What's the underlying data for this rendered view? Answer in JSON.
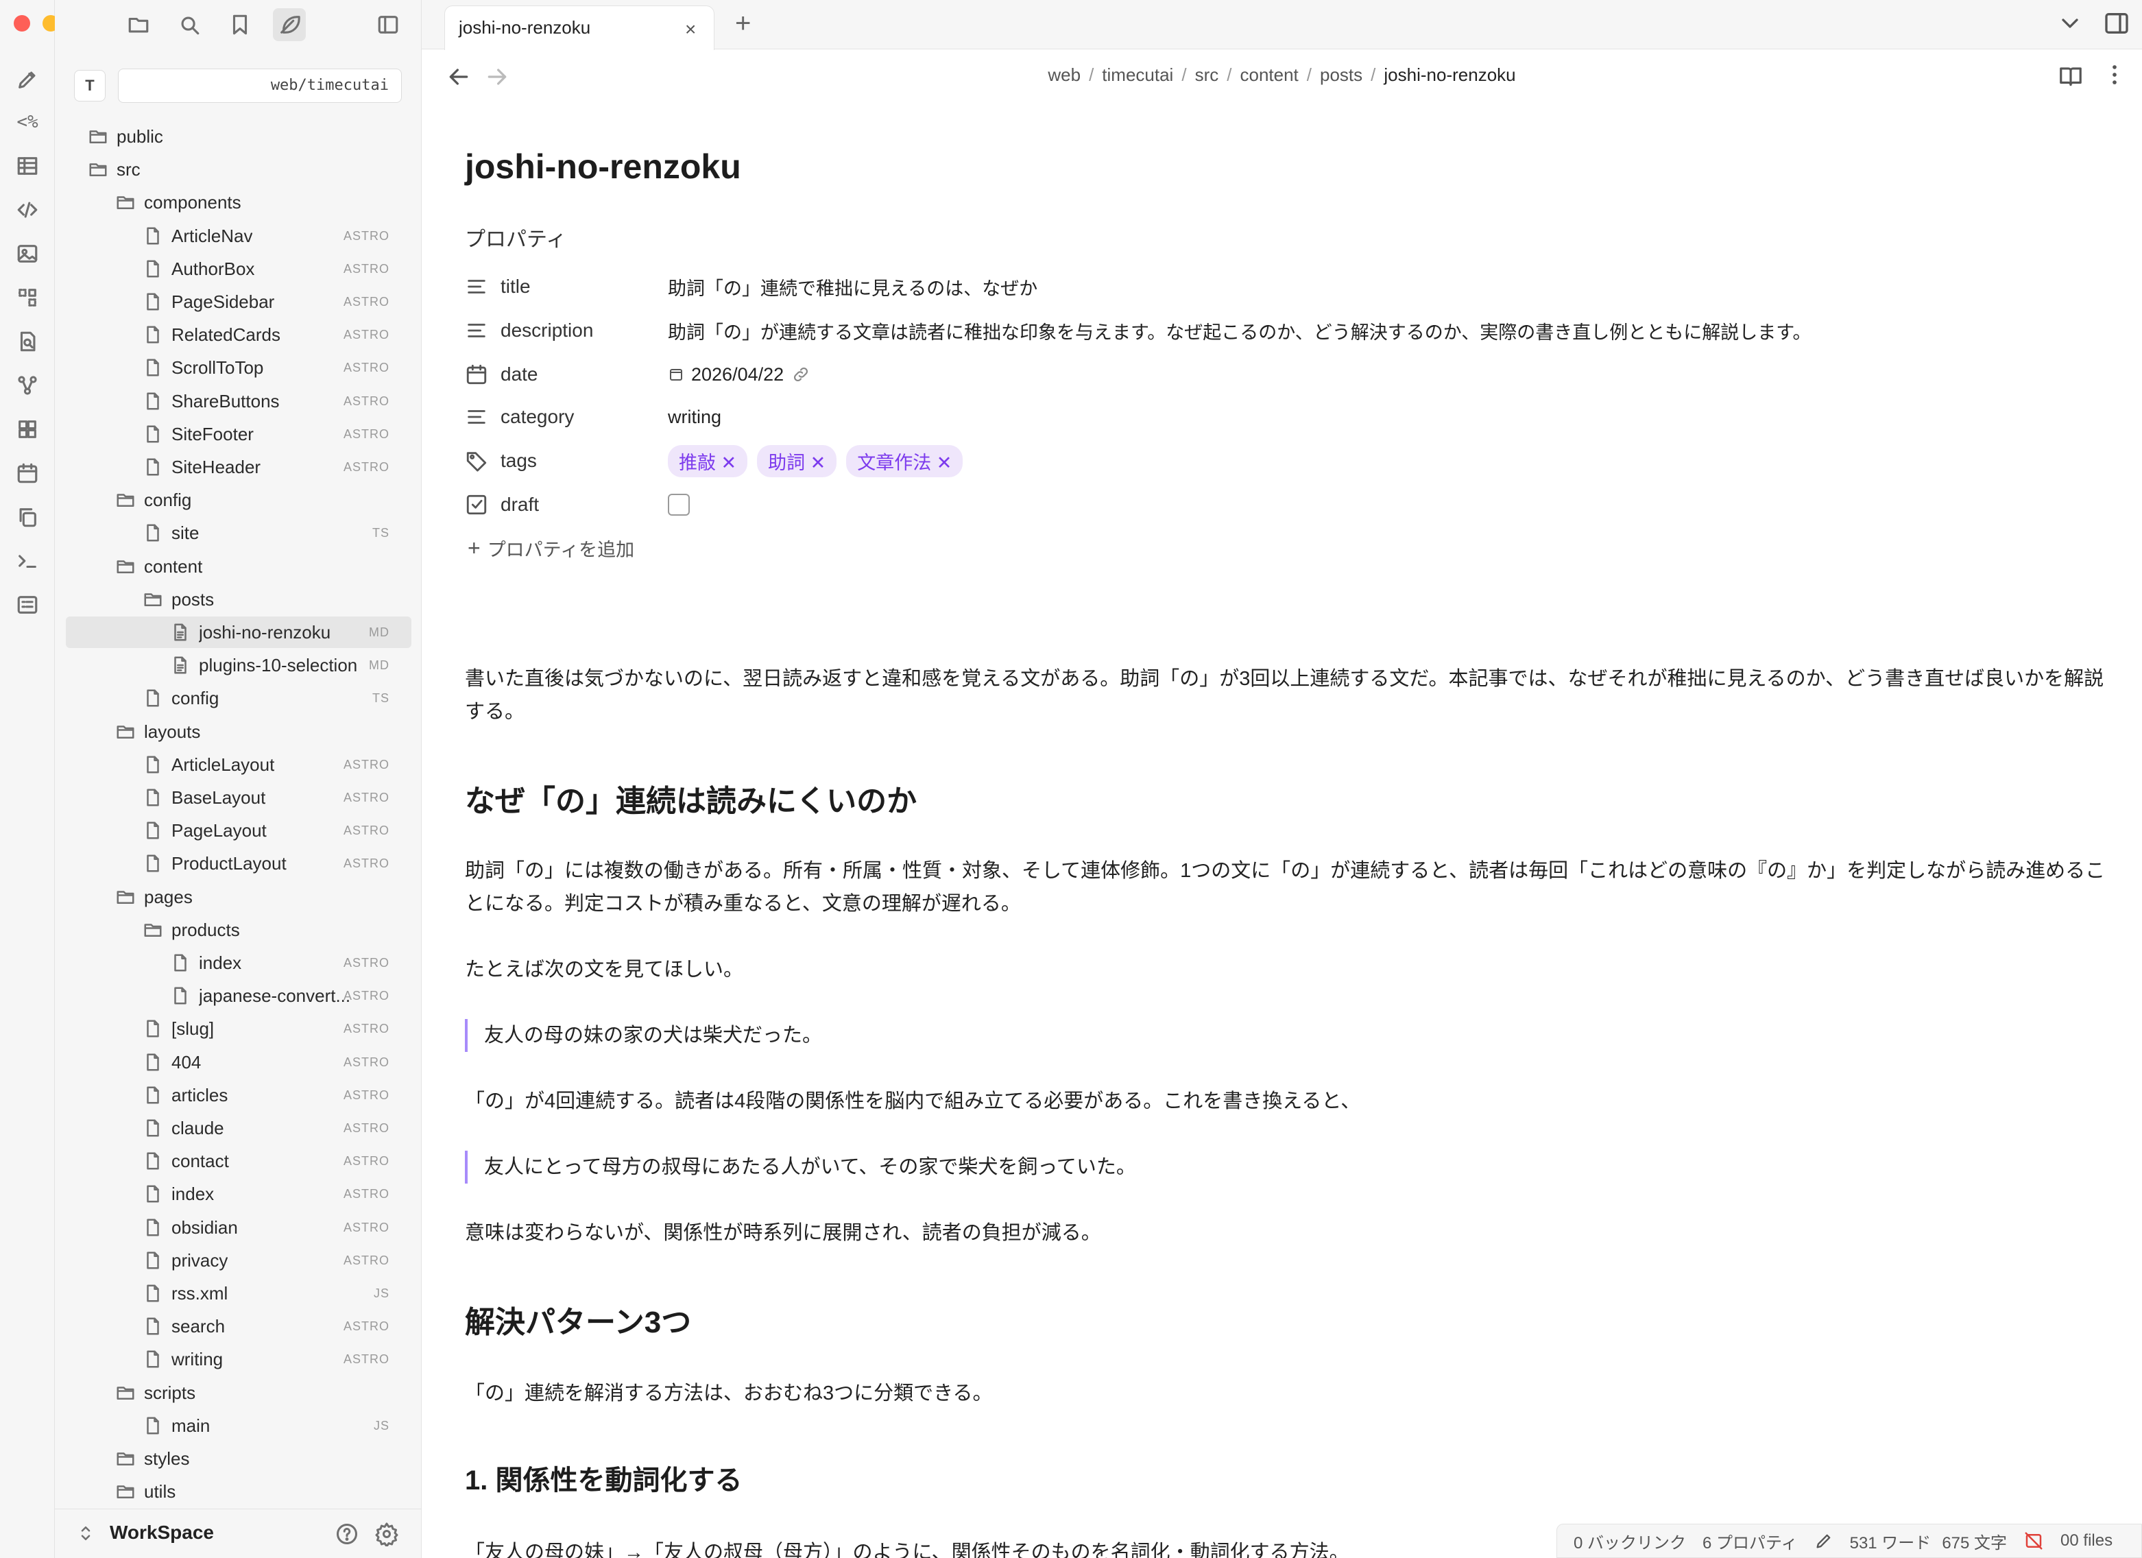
{
  "window": {
    "traffic_colors": [
      "#fe5f57",
      "#febc2e",
      "#28c840"
    ]
  },
  "sidebar": {
    "vault_initial": "T",
    "vault_path": "web/timecutai",
    "workspace": "WorkSpace",
    "tree": [
      {
        "label": "public",
        "type": "folder",
        "depth": 0,
        "ext": ""
      },
      {
        "label": "src",
        "type": "folder",
        "depth": 0,
        "ext": ""
      },
      {
        "label": "components",
        "type": "folder",
        "depth": 1,
        "ext": ""
      },
      {
        "label": "ArticleNav",
        "type": "file",
        "depth": 2,
        "ext": "ASTRO"
      },
      {
        "label": "AuthorBox",
        "type": "file",
        "depth": 2,
        "ext": "ASTRO"
      },
      {
        "label": "PageSidebar",
        "type": "file",
        "depth": 2,
        "ext": "ASTRO"
      },
      {
        "label": "RelatedCards",
        "type": "file",
        "depth": 2,
        "ext": "ASTRO"
      },
      {
        "label": "ScrollToTop",
        "type": "file",
        "depth": 2,
        "ext": "ASTRO"
      },
      {
        "label": "ShareButtons",
        "type": "file",
        "depth": 2,
        "ext": "ASTRO"
      },
      {
        "label": "SiteFooter",
        "type": "file",
        "depth": 2,
        "ext": "ASTRO"
      },
      {
        "label": "SiteHeader",
        "type": "file",
        "depth": 2,
        "ext": "ASTRO"
      },
      {
        "label": "config",
        "type": "folder",
        "depth": 1,
        "ext": ""
      },
      {
        "label": "site",
        "type": "file",
        "depth": 2,
        "ext": "TS"
      },
      {
        "label": "content",
        "type": "folder",
        "depth": 1,
        "ext": ""
      },
      {
        "label": "posts",
        "type": "folder",
        "depth": 2,
        "ext": ""
      },
      {
        "label": "joshi-no-renzoku",
        "type": "doc",
        "depth": 3,
        "ext": "MD",
        "active": true
      },
      {
        "label": "plugins-10-selection",
        "type": "doc",
        "depth": 3,
        "ext": "MD"
      },
      {
        "label": "config",
        "type": "file",
        "depth": 2,
        "ext": "TS"
      },
      {
        "label": "layouts",
        "type": "folder",
        "depth": 1,
        "ext": ""
      },
      {
        "label": "ArticleLayout",
        "type": "file",
        "depth": 2,
        "ext": "ASTRO"
      },
      {
        "label": "BaseLayout",
        "type": "file",
        "depth": 2,
        "ext": "ASTRO"
      },
      {
        "label": "PageLayout",
        "type": "file",
        "depth": 2,
        "ext": "ASTRO"
      },
      {
        "label": "ProductLayout",
        "type": "file",
        "depth": 2,
        "ext": "ASTRO"
      },
      {
        "label": "pages",
        "type": "folder",
        "depth": 1,
        "ext": ""
      },
      {
        "label": "products",
        "type": "folder",
        "depth": 2,
        "ext": ""
      },
      {
        "label": "index",
        "type": "file",
        "depth": 3,
        "ext": "ASTRO"
      },
      {
        "label": "japanese-convert...",
        "type": "file",
        "depth": 3,
        "ext": "ASTRO"
      },
      {
        "label": "[slug]",
        "type": "file",
        "depth": 2,
        "ext": "ASTRO"
      },
      {
        "label": "404",
        "type": "file",
        "depth": 2,
        "ext": "ASTRO"
      },
      {
        "label": "articles",
        "type": "file",
        "depth": 2,
        "ext": "ASTRO"
      },
      {
        "label": "claude",
        "type": "file",
        "depth": 2,
        "ext": "ASTRO"
      },
      {
        "label": "contact",
        "type": "file",
        "depth": 2,
        "ext": "ASTRO"
      },
      {
        "label": "index",
        "type": "file",
        "depth": 2,
        "ext": "ASTRO"
      },
      {
        "label": "obsidian",
        "type": "file",
        "depth": 2,
        "ext": "ASTRO"
      },
      {
        "label": "privacy",
        "type": "file",
        "depth": 2,
        "ext": "ASTRO"
      },
      {
        "label": "rss.xml",
        "type": "file",
        "depth": 2,
        "ext": "JS"
      },
      {
        "label": "search",
        "type": "file",
        "depth": 2,
        "ext": "ASTRO"
      },
      {
        "label": "writing",
        "type": "file",
        "depth": 2,
        "ext": "ASTRO"
      },
      {
        "label": "scripts",
        "type": "folder",
        "depth": 1,
        "ext": ""
      },
      {
        "label": "main",
        "type": "file",
        "depth": 2,
        "ext": "JS"
      },
      {
        "label": "styles",
        "type": "folder",
        "depth": 1,
        "ext": ""
      },
      {
        "label": "utils",
        "type": "folder",
        "depth": 1,
        "ext": ""
      }
    ]
  },
  "tab": {
    "title": "joshi-no-renzoku",
    "close": "×",
    "new": "+"
  },
  "breadcrumb": [
    "web",
    "timecutai",
    "src",
    "content",
    "posts",
    "joshi-no-renzoku"
  ],
  "note": {
    "title": "joshi-no-renzoku",
    "properties_heading": "プロパティ",
    "properties": {
      "title": {
        "key": "title",
        "value": "助詞「の」連続で稚拙に見えるのは、なぜか"
      },
      "description": {
        "key": "description",
        "value": "助詞「の」が連続する文章は読者に稚拙な印象を与えます。なぜ起こるのか、どう解決するのか、実際の書き直し例とともに解説します。"
      },
      "date": {
        "key": "date",
        "value": "2026/04/22"
      },
      "category": {
        "key": "category",
        "value": "writing"
      },
      "tags": {
        "key": "tags",
        "values": [
          "推敲",
          "助詞",
          "文章作法"
        ]
      },
      "draft": {
        "key": "draft",
        "checked": false
      }
    },
    "add_property": "プロパティを追加",
    "body": {
      "intro": "書いた直後は気づかないのに、翌日読み返すと違和感を覚える文がある。助詞「の」が3回以上連続する文だ。本記事では、なぜそれが稚拙に見えるのか、どう書き直せば良いかを解説する。",
      "h2_1": "なぜ「の」連続は読みにくいのか",
      "p1": "助詞「の」には複数の働きがある。所有・所属・性質・対象、そして連体修飾。1つの文に「の」が連続すると、読者は毎回「これはどの意味の『の』か」を判定しながら読み進めることになる。判定コストが積み重なると、文意の理解が遅れる。",
      "p2": "たとえば次の文を見てほしい。",
      "quote1": "友人の母の妹の家の犬は柴犬だった。",
      "p3": "「の」が4回連続する。読者は4段階の関係性を脳内で組み立てる必要がある。これを書き換えると、",
      "quote2": "友人にとって母方の叔母にあたる人がいて、その家で柴犬を飼っていた。",
      "p4": "意味は変わらないが、関係性が時系列に展開され、読者の負担が減る。",
      "h2_2": "解決パターン3つ",
      "p5": "「の」連続を解消する方法は、おおむね3つに分類できる。",
      "h3_1": "1. 関係性を動詞化する",
      "p6": "「友人の母の妹」→「友人の叔母（母方）」のように、関係性そのものを名詞化・動詞化する方法。"
    }
  },
  "status": {
    "backlinks": "0 バックリンク",
    "properties": "6 プロパティ",
    "words": "531 ワード",
    "chars": "675 文字",
    "files": "00 files"
  }
}
